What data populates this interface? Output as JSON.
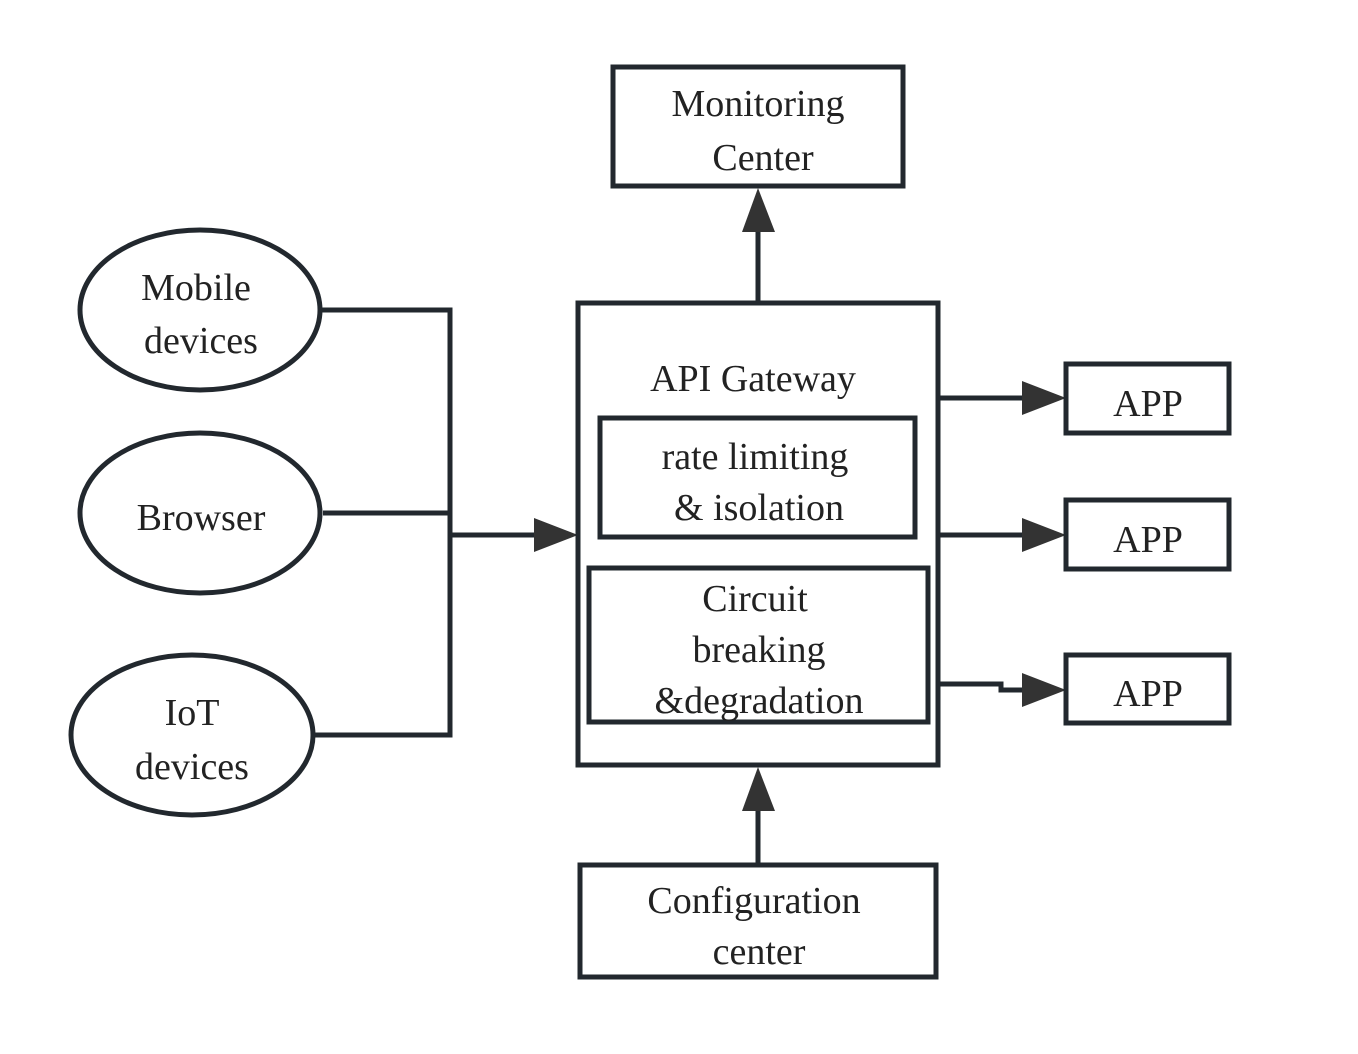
{
  "nodes": {
    "monitoring": [
      "Monitoring",
      "Center"
    ],
    "mobile": [
      "Mobile",
      "devices"
    ],
    "browser": [
      "Browser"
    ],
    "iot": [
      "IoT",
      "devices"
    ],
    "gateway_title": "API Gateway",
    "rate_limiting": [
      "rate limiting",
      "& isolation"
    ],
    "circuit": [
      "Circuit",
      "breaking",
      "&degradation"
    ],
    "app1": "APP",
    "app2": "APP",
    "app3": "APP",
    "config": [
      "Configuration",
      "center"
    ]
  },
  "colors": {
    "stroke": "#22282e",
    "arrowhead": "#333333"
  }
}
